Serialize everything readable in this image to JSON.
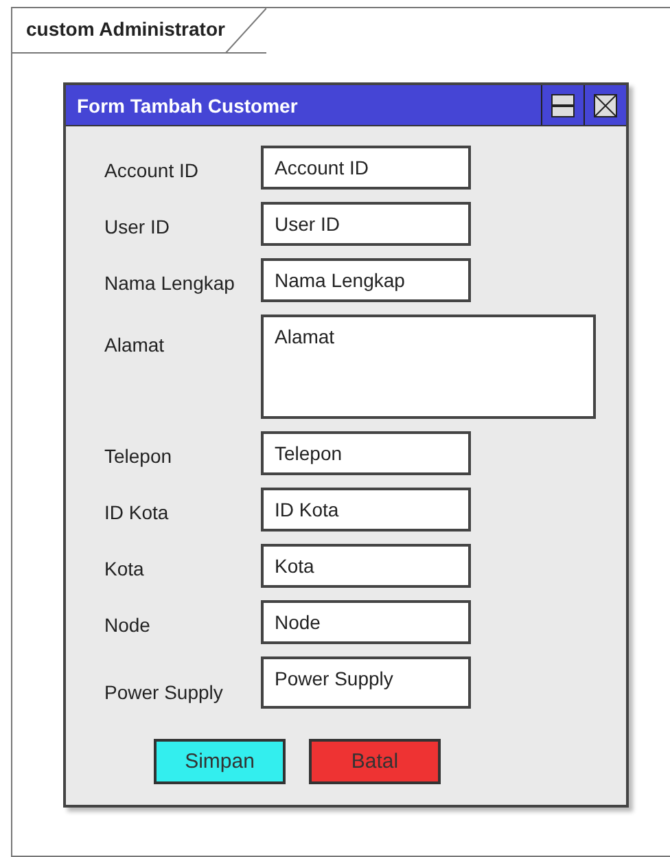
{
  "frame": {
    "title": "custom Administrator"
  },
  "window": {
    "title": "Form Tambah Customer"
  },
  "fields": [
    {
      "kind": "line",
      "label": "Account ID",
      "value": "Account ID"
    },
    {
      "kind": "line",
      "label": "User ID",
      "value": "User ID"
    },
    {
      "kind": "line",
      "label": "Nama Lengkap",
      "value": "Nama Lengkap"
    },
    {
      "kind": "multiline",
      "label": "Alamat",
      "value": "Alamat"
    },
    {
      "kind": "line",
      "label": "Telepon",
      "value": "Telepon"
    },
    {
      "kind": "line",
      "label": "ID Kota",
      "value": "ID Kota"
    },
    {
      "kind": "line",
      "label": "Kota",
      "value": "Kota"
    },
    {
      "kind": "line",
      "label": "Node",
      "value": "Node"
    },
    {
      "kind": "tall",
      "label": "Power Supply",
      "value": "Power Supply"
    }
  ],
  "buttons": [
    {
      "label": "Simpan",
      "color": "#33eeee"
    },
    {
      "label": "Batal",
      "color": "#ee3333"
    }
  ]
}
